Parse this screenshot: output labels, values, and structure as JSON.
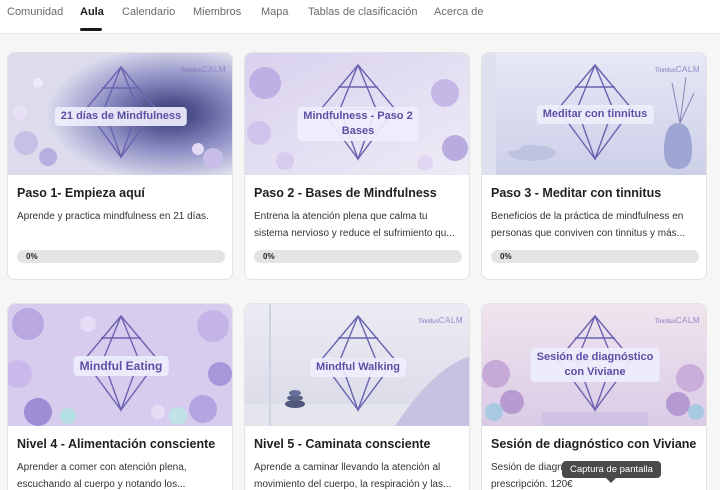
{
  "nav": {
    "tabs": [
      "Comunidad",
      "Aula",
      "Calendario",
      "Miembros",
      "Mapa",
      "Tablas de clasificación",
      "Acerca de"
    ],
    "active": "Aula"
  },
  "brand": {
    "prefix": "Tinnitus",
    "name": "CALM"
  },
  "courses": [
    {
      "thumb_label": "21 días de Mindfulness",
      "title": "Paso 1- Empieza aquí",
      "desc1": "Aprende y practica mindfulness en 21 días.",
      "desc2": "",
      "progress_pct": 0,
      "progress_label": "0%"
    },
    {
      "thumb_label_1": "Mindfulness - Paso 2",
      "thumb_label_2": "Bases",
      "title": "Paso 2 - Bases de Mindfulness",
      "desc1": "Entrena la atención plena que calma tu",
      "desc2": "sistema nervioso y reduce el sufrimiento qu...",
      "progress_pct": 0,
      "progress_label": "0%"
    },
    {
      "thumb_label": "Meditar con tinnitus",
      "title": "Paso 3 - Meditar con tinnitus",
      "desc1": "Beneficios de la práctica de mindfulness en",
      "desc2": "personas que conviven con tinnitus y más...",
      "progress_pct": 0,
      "progress_label": "0%"
    },
    {
      "thumb_label": "Mindful Eating",
      "title": "Nivel 4 - Alimentación consciente",
      "desc1": "Aprender a comer con atención plena,",
      "desc2": "escuchando al cuerpo y notando los..."
    },
    {
      "thumb_label": "Mindful Walking",
      "title": "Nivel 5 - Caminata consciente",
      "desc1": "Aprende a caminar llevando la atención al",
      "desc2": "movimiento del cuerpo, la respiración y las..."
    },
    {
      "thumb_label_1": "Sesión de diagnóstico",
      "thumb_label_2": "con Viviane",
      "title": "Sesión de diagnóstico con Viviane",
      "desc1": "Sesión de diagn",
      "desc2": "prescripción. 120€"
    }
  ],
  "tooltip": "Captura de pantalla",
  "colors": {
    "accent": "#5b4fa6",
    "progress_track": "#e4e4e4"
  }
}
